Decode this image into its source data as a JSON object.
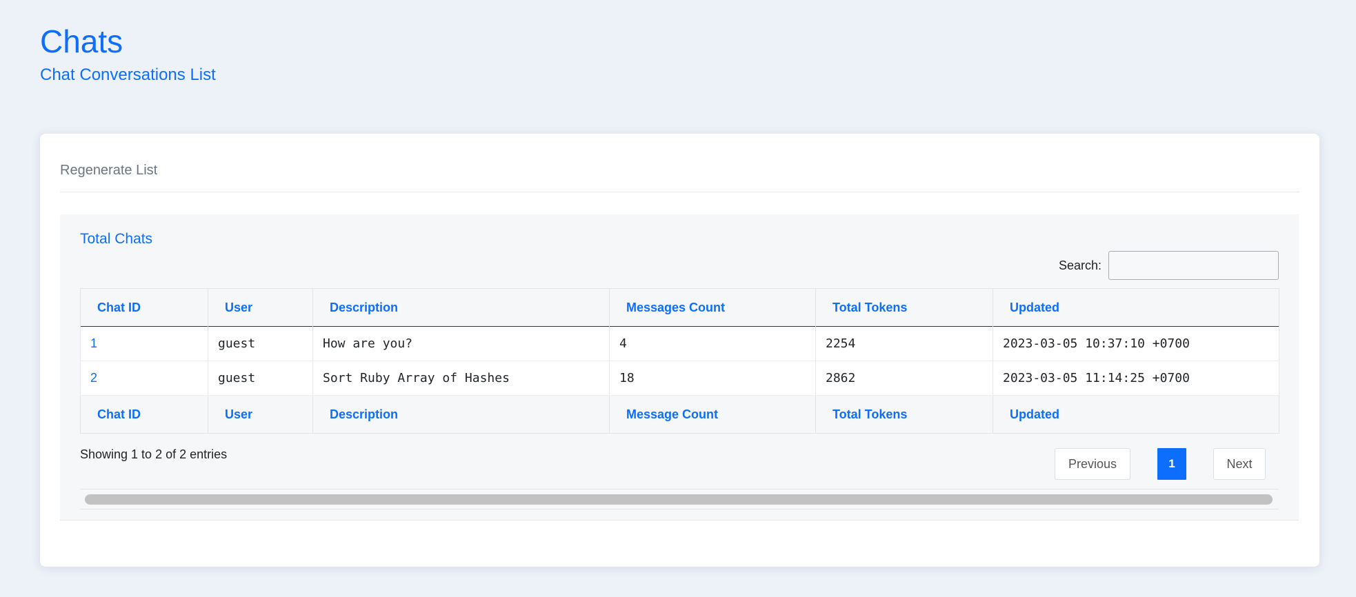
{
  "header": {
    "title": "Chats",
    "subtitle": "Chat Conversations List"
  },
  "card": {
    "regenerate_label": "Regenerate List"
  },
  "panel": {
    "title": "Total Chats",
    "search_label": "Search:",
    "search_value": ""
  },
  "table": {
    "header_columns": [
      "Chat ID",
      "User",
      "Description",
      "Messages Count",
      "Total Tokens",
      "Updated"
    ],
    "footer_columns": [
      "Chat ID",
      "User",
      "Description",
      "Message Count",
      "Total Tokens",
      "Updated"
    ],
    "rows": [
      {
        "chat_id": "1",
        "user": "guest",
        "description": "How are you?",
        "messages_count": "4",
        "total_tokens": "2254",
        "updated": "2023-03-05 10:37:10 +0700"
      },
      {
        "chat_id": "2",
        "user": "guest",
        "description": "Sort Ruby Array of Hashes",
        "messages_count": "18",
        "total_tokens": "2862",
        "updated": "2023-03-05 11:14:25 +0700"
      }
    ]
  },
  "footer": {
    "info": "Showing 1 to 2 of 2 entries",
    "previous_label": "Previous",
    "current_page": "1",
    "next_label": "Next"
  },
  "colors": {
    "accent": "#0d6efd",
    "background": "#edf1f8"
  }
}
